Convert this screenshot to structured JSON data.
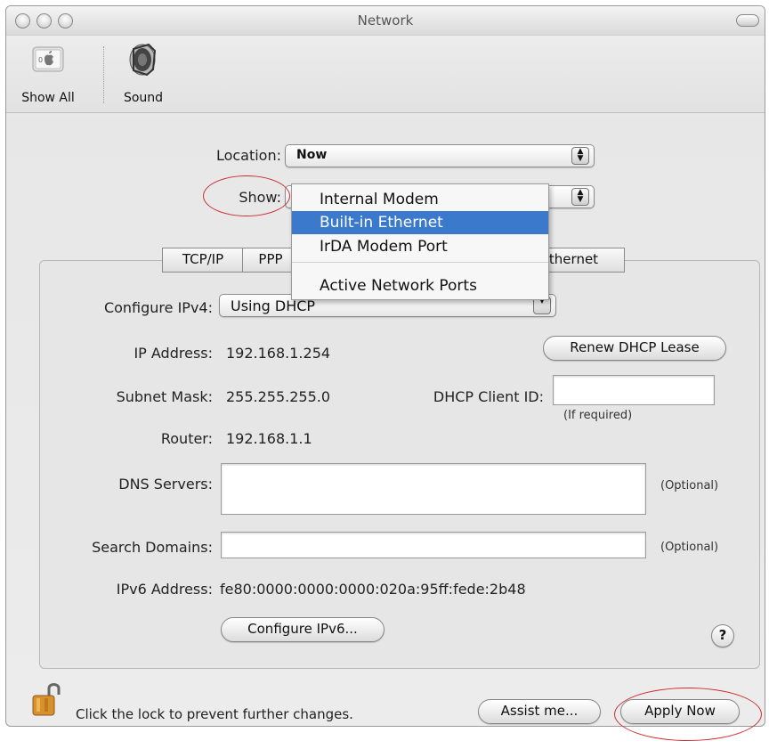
{
  "window": {
    "title": "Network"
  },
  "toolbar": {
    "items": [
      {
        "label": "Show All",
        "icon": "apple-logo-icon"
      },
      {
        "label": "Sound",
        "icon": "speaker-icon"
      }
    ]
  },
  "form": {
    "location_label": "Location:",
    "location_value": "Now",
    "show_label": "Show:",
    "show_menu": {
      "items": [
        "Internal Modem",
        "Built-in Ethernet",
        "IrDA Modem Port",
        "Active Network Ports"
      ],
      "selected": "Built-in Ethernet"
    }
  },
  "tabs": {
    "items": [
      "TCP/IP",
      "PPP",
      "thernet"
    ]
  },
  "tcpip": {
    "configure_label": "Configure IPv4:",
    "configure_value": "Using DHCP",
    "ip_label": "IP Address:",
    "ip_value": "192.168.1.254",
    "renew_button": "Renew DHCP Lease",
    "subnet_label": "Subnet Mask:",
    "subnet_value": "255.255.255.0",
    "client_id_label": "DHCP Client ID:",
    "client_id_value": "",
    "client_id_hint": "(If required)",
    "router_label": "Router:",
    "router_value": "192.168.1.1",
    "dns_label": "DNS Servers:",
    "dns_value": "",
    "dns_hint": "(Optional)",
    "search_label": "Search Domains:",
    "search_value": "",
    "search_hint": "(Optional)",
    "ipv6_label": "IPv6 Address:",
    "ipv6_value": "fe80:0000:0000:0000:020a:95ff:fede:2b48",
    "configure_ipv6_button": "Configure IPv6...",
    "help_label": "?"
  },
  "footer": {
    "lock_text": "Click the lock to prevent further changes.",
    "assist_button": "Assist me...",
    "apply_button": "Apply Now"
  },
  "colors": {
    "annotation": "#cc2e35",
    "menu_selected": "#3b79cd"
  }
}
